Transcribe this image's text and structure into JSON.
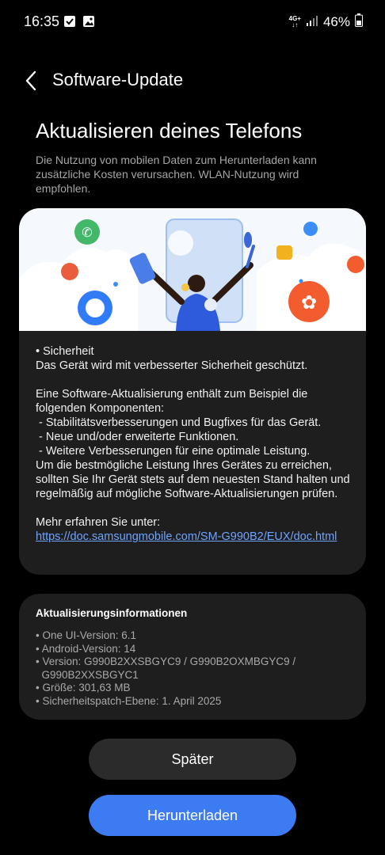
{
  "status_bar": {
    "time": "16:35",
    "network_top": "4G+",
    "network_bottom": "↓↑",
    "battery": "46%"
  },
  "header": {
    "title": "Software-Update"
  },
  "main": {
    "heading": "Aktualisieren deines Telefons",
    "intro": "Die Nutzung von mobilen Daten zum Herunterladen kann zusätzliche Kosten verursachen. WLAN-Nutzung wird empfohlen."
  },
  "details": {
    "security_title": "• Sicherheit",
    "security_text": "Das Gerät wird mit verbesserter Sicherheit geschützt.",
    "components_intro": "Eine Software-Aktualisierung enthält zum Beispiel die folgenden Komponenten:",
    "components": [
      " - Stabilitätsverbesserungen und Bugfixes für das Gerät.",
      " - Neue und/oder erweiterte Funktionen.",
      " - Weitere Verbesserungen für eine optimale Leistung."
    ],
    "recommendation": "Um die bestmögliche Leistung Ihres Gerätes zu erreichen, sollten Sie Ihr Gerät stets auf dem neuesten Stand halten und regelmäßig auf mögliche Software-Aktualisierungen prüfen.",
    "more_info_label": "Mehr erfahren Sie unter:",
    "more_info_link": "https://doc.samsungmobile.com/SM-G990B2/EUX/doc.html"
  },
  "update_info": {
    "title": "Aktualisierungsinformationen",
    "items": [
      "• One UI-Version: 6.1",
      "• Android-Version: 14",
      "• Version: G990B2XXSBGYC9 / G990B2OXMBGYC9 /",
      "  G990B2XXSBGYC1",
      "• Größe: 301,63 MB",
      "• Sicherheitspatch-Ebene: 1. April 2025"
    ]
  },
  "buttons": {
    "later": "Später",
    "download": "Herunterladen"
  },
  "colors": {
    "background": "#000000",
    "card": "#1e1e1e",
    "accent_button": "#3d7bf3",
    "secondary_button": "#2b2b2b",
    "link": "#6fa4ff"
  },
  "icons": [
    "chevron-left-icon",
    "checkbox-notification-icon",
    "gallery-notification-icon",
    "signal-icon",
    "battery-icon"
  ]
}
